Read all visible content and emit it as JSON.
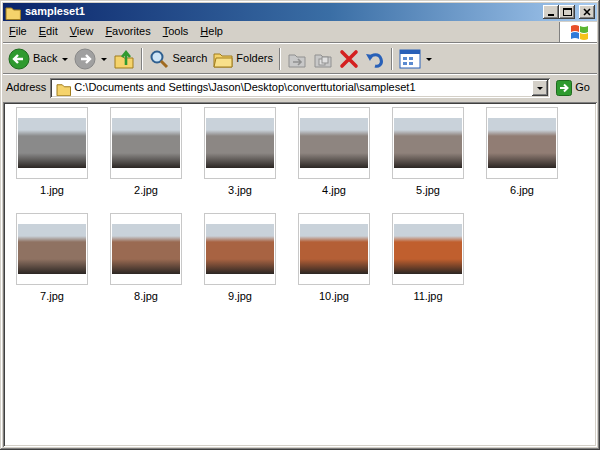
{
  "window": {
    "title": "sampleset1"
  },
  "menu": [
    "File",
    "Edit",
    "View",
    "Favorites",
    "Tools",
    "Help"
  ],
  "toolbar": [
    {
      "kind": "back",
      "label": "Back",
      "disabled": false
    },
    {
      "kind": "forward",
      "disabled": true
    },
    {
      "kind": "up",
      "disabled": false
    },
    {
      "kind": "search",
      "label": "Search",
      "disabled": false
    },
    {
      "kind": "folders",
      "label": "Folders",
      "disabled": false
    },
    {
      "kind": "move",
      "disabled": true
    },
    {
      "kind": "copy",
      "disabled": true
    },
    {
      "kind": "delete",
      "disabled": false
    },
    {
      "kind": "undo",
      "disabled": false
    },
    {
      "kind": "views",
      "disabled": false
    }
  ],
  "address": {
    "label": "Address",
    "value": "C:\\Documents and Settings\\Jason\\Desktop\\converttutorial\\sampleset1",
    "go": "Go"
  },
  "files": [
    {
      "name": "1.jpg",
      "color": "#8a8a8a"
    },
    {
      "name": "2.jpg",
      "color": "#8b8987"
    },
    {
      "name": "3.jpg",
      "color": "#8c8784"
    },
    {
      "name": "4.jpg",
      "color": "#8e8580"
    },
    {
      "name": "5.jpg",
      "color": "#8f827b"
    },
    {
      "name": "6.jpg",
      "color": "#917d74"
    },
    {
      "name": "7.jpg",
      "color": "#8f7262"
    },
    {
      "name": "8.jpg",
      "color": "#9a6a52"
    },
    {
      "name": "9.jpg",
      "color": "#a86342"
    },
    {
      "name": "10.jpg",
      "color": "#b45f36"
    },
    {
      "name": "11.jpg",
      "color": "#c05f2e"
    }
  ]
}
